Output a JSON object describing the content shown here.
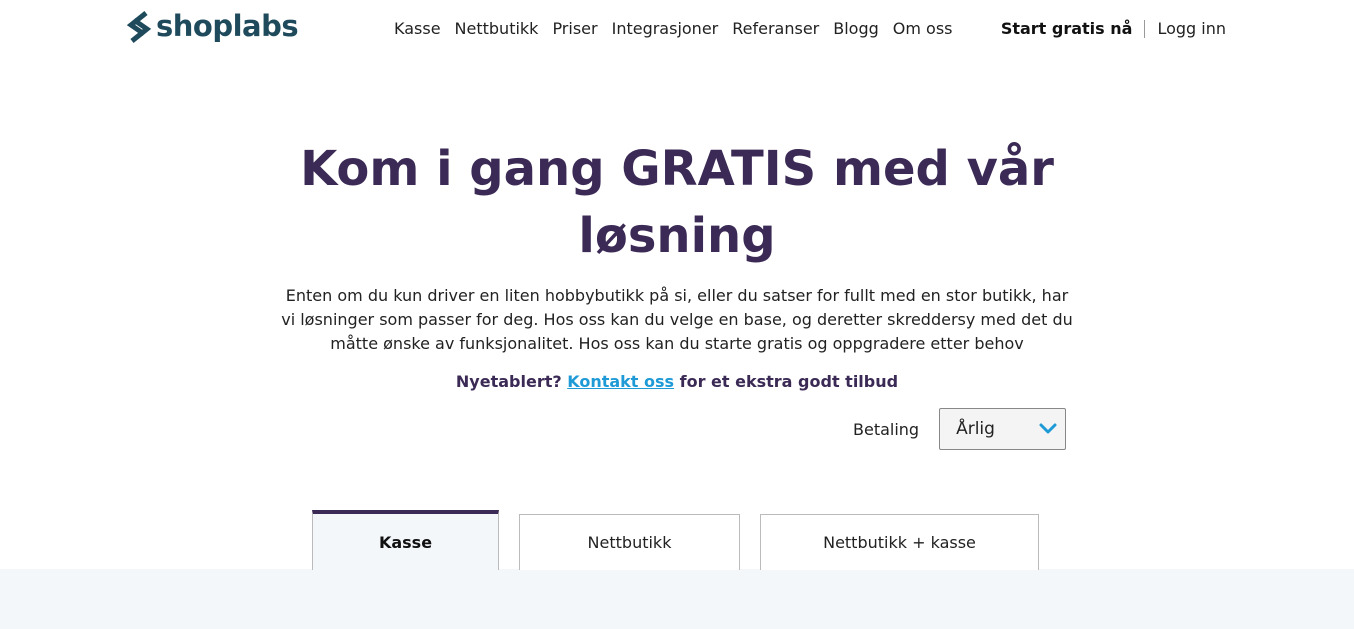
{
  "brand": {
    "name": "shoplabs",
    "icon": "shoplabs-logo-icon",
    "color": "#1e4a5c"
  },
  "nav": {
    "items": [
      "Kasse",
      "Nettbutikk",
      "Priser",
      "Integrasjoner",
      "Referanser",
      "Blogg",
      "Om oss"
    ]
  },
  "auth": {
    "start_label": "Start gratis nå",
    "login_label": "Logg inn"
  },
  "hero": {
    "title_line1": "Kom i gang GRATIS med vår",
    "title_line2": "løsning",
    "title_color": "#3b2a55",
    "text": "Enten om du kun driver en liten hobbybutikk på si, eller du satser for fullt med en stor butikk, har vi løsninger som passer for deg. Hos oss kan du velge en base, og deretter skreddersy med det du måtte ønske av funksjonalitet. Hos oss kan du starte gratis og oppgradere etter behov"
  },
  "promo": {
    "prefix": "Nyetablert?",
    "link": "Kontakt oss",
    "suffix": "for et ekstra godt tilbud",
    "link_color": "#1e9ad6"
  },
  "payment": {
    "label": "Betaling",
    "selected": "Årlig",
    "icon": "chevron-down-icon",
    "accent": "#1e9ad6"
  },
  "tabs": [
    {
      "label": "Kasse",
      "active": true
    },
    {
      "label": "Nettbutikk",
      "active": false
    },
    {
      "label": "Nettbutikk + kasse",
      "active": false
    }
  ]
}
